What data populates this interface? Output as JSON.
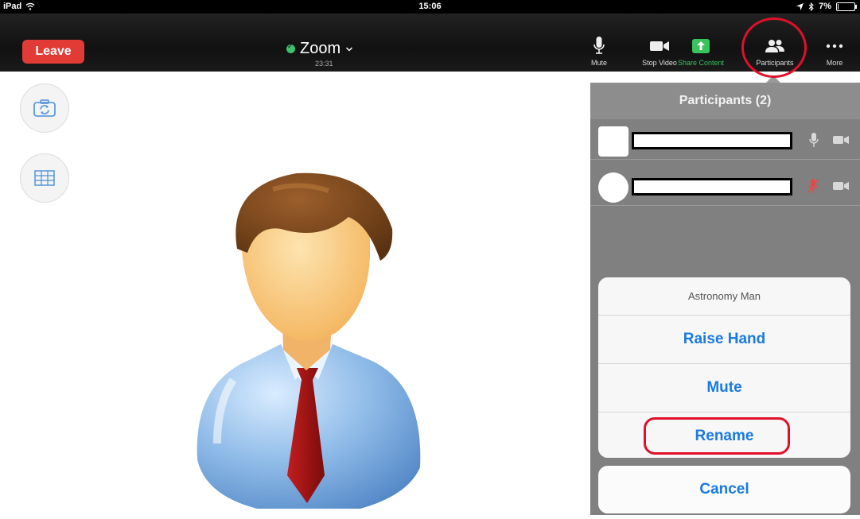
{
  "status_bar": {
    "device": "iPad",
    "time": "15:06",
    "battery": "7%",
    "battery_level": 0.07
  },
  "toolbar": {
    "leave_label": "Leave",
    "meeting_name": "Zoom",
    "meeting_timer": "23:31",
    "buttons": [
      {
        "label": "Mute",
        "icon": "microphone-icon"
      },
      {
        "label": "Stop Video",
        "icon": "video-camera-icon"
      },
      {
        "label": "Share Content",
        "icon": "share-arrow-icon"
      },
      {
        "label": "Participants",
        "icon": "participants-icon"
      },
      {
        "label": "More",
        "icon": "more-dots-icon"
      }
    ]
  },
  "side_buttons": [
    {
      "icon": "switch-camera-icon"
    },
    {
      "icon": "gallery-grid-icon"
    }
  ],
  "participants_panel": {
    "title": "Participants (2)",
    "rows": [
      {
        "avatar_shape": "square",
        "mic": "on",
        "video": "on"
      },
      {
        "avatar_shape": "round",
        "mic": "muted",
        "video": "on"
      }
    ]
  },
  "action_sheet": {
    "title": "Astronomy Man",
    "items": [
      "Raise Hand",
      "Mute",
      "Rename"
    ],
    "cancel_label": "Cancel"
  },
  "colors": {
    "leave": "#e23b36",
    "share_content": "#38c35c",
    "action_blue": "#1a7ae0",
    "highlight_red": "#e0102a"
  }
}
